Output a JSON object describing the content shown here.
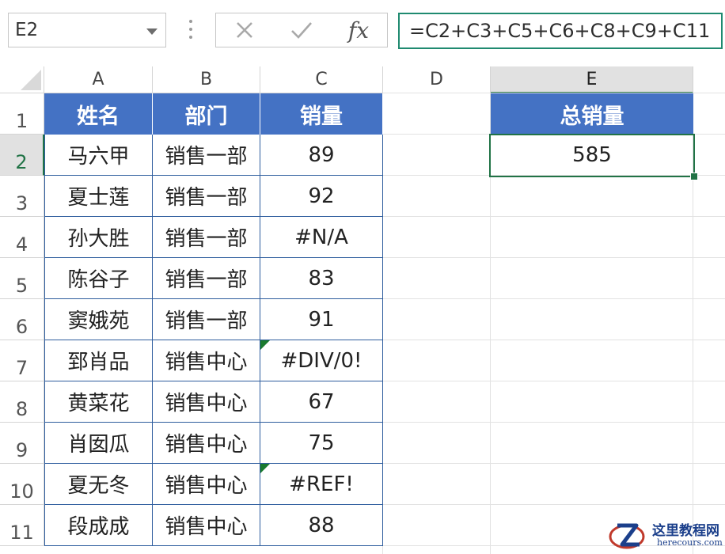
{
  "formula_bar": {
    "name_box": "E2",
    "cancel_icon": "close-icon",
    "enter_icon": "check-icon",
    "fx_label": "fx",
    "formula": "=C2+C3+C5+C6+C8+C9+C11"
  },
  "columns": [
    "A",
    "B",
    "C",
    "D",
    "E"
  ],
  "rows": [
    "1",
    "2",
    "3",
    "4",
    "5",
    "6",
    "7",
    "8",
    "9",
    "10",
    "11"
  ],
  "table": {
    "headers": [
      "姓名",
      "部门",
      "销量"
    ],
    "rows": [
      [
        "马六甲",
        "销售一部",
        "89"
      ],
      [
        "夏士莲",
        "销售一部",
        "92"
      ],
      [
        "孙大胜",
        "销售一部",
        "#N/A"
      ],
      [
        "陈谷子",
        "销售一部",
        "83"
      ],
      [
        "窦娥苑",
        "销售一部",
        "91"
      ],
      [
        "郅肖品",
        "销售中心",
        "#DIV/0!"
      ],
      [
        "黄菜花",
        "销售中心",
        "67"
      ],
      [
        "肖囡瓜",
        "销售中心",
        "75"
      ],
      [
        "夏无冬",
        "销售中心",
        "#REF!"
      ],
      [
        "段成成",
        "销售中心",
        "88"
      ]
    ]
  },
  "summary": {
    "header": "总销量",
    "value": "585"
  },
  "watermark": {
    "site_name": "这里教程网",
    "domain": "herecours.com"
  },
  "colors": {
    "header_fill": "#4472c4",
    "selection": "#217346",
    "formula_border": "#1f8a70",
    "error_indicator": "#1a7a2e"
  }
}
